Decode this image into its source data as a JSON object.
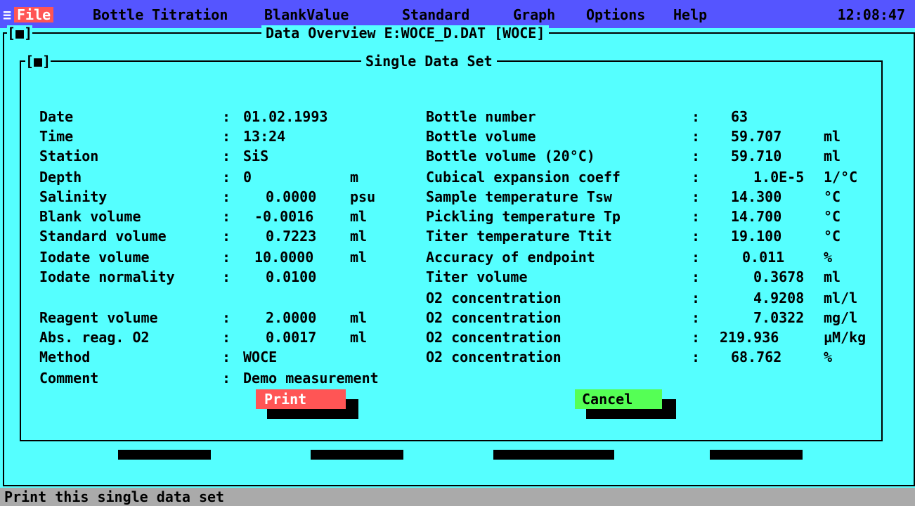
{
  "menu": {
    "sys_icon": "≡",
    "items": [
      "File",
      "Bottle",
      "Titration",
      "BlankValue",
      "Standard",
      "Graph",
      "Options",
      "Help"
    ],
    "clock": "12:08:47"
  },
  "window": {
    "title": "Data Overview E:WOCE_D.DAT [WOCE]",
    "close": "[■]"
  },
  "dialog": {
    "title": "Single Data Set",
    "close": "[■]"
  },
  "left": [
    {
      "label": "Date",
      "sep": ":",
      "value": "01.02.1993",
      "unit": ""
    },
    {
      "label": "Time",
      "sep": ":",
      "value": "13:24",
      "unit": ""
    },
    {
      "label": "Station",
      "sep": ":",
      "value": "SiS",
      "unit": ""
    },
    {
      "label": "Depth",
      "sep": ":",
      "value": "0",
      "unit": "m"
    },
    {
      "label": "Salinity",
      "sep": ":",
      "value": "0.0000",
      "unit": "psu"
    },
    {
      "label": "Blank volume",
      "sep": ":",
      "value": "-0.0016",
      "unit": "ml"
    },
    {
      "label": "Standard volume",
      "sep": ":",
      "value": "0.7223",
      "unit": "ml"
    },
    {
      "label": "Iodate volume",
      "sep": ":",
      "value": "10.0000",
      "unit": "ml"
    },
    {
      "label": "Iodate normality",
      "sep": ":",
      "value": "0.0100",
      "unit": ""
    },
    {
      "label": "Reagent volume",
      "sep": ":",
      "value": "2.0000",
      "unit": "ml"
    },
    {
      "label": "Abs. reag. O2",
      "sep": ":",
      "value": "0.0017",
      "unit": "ml"
    },
    {
      "label": "Method",
      "sep": ":",
      "value": "WOCE",
      "unit": ""
    },
    {
      "label": "Comment",
      "sep": ":",
      "value": "Demo measurement",
      "unit": ""
    }
  ],
  "right": [
    {
      "label": "Bottle number",
      "sep": ":",
      "value": "63",
      "unit": ""
    },
    {
      "label": "Bottle volume",
      "sep": ":",
      "value": "59.707",
      "unit": "ml"
    },
    {
      "label": "Bottle volume (20°C)",
      "sep": ":",
      "value": "59.710",
      "unit": "ml"
    },
    {
      "label": "Cubical expansion coeff",
      "sep": ":",
      "value": "1.0E-5",
      "unit": "1/°C"
    },
    {
      "label": "Sample temperature Tsw",
      "sep": ":",
      "value": "14.300",
      "unit": "°C"
    },
    {
      "label": "Pickling temperature Tp",
      "sep": ":",
      "value": "14.700",
      "unit": "°C"
    },
    {
      "label": "Titer temperature Ttit",
      "sep": ":",
      "value": "19.100",
      "unit": "°C"
    },
    {
      "label": "Accuracy of endpoint",
      "sep": ":",
      "value": "0.011",
      "unit": "%"
    },
    {
      "label": "Titer volume",
      "sep": ":",
      "value": "0.3678",
      "unit": "ml"
    },
    {
      "label": "O2 concentration",
      "sep": ":",
      "value": "4.9208",
      "unit": "ml/l"
    },
    {
      "label": "O2 concentration",
      "sep": ":",
      "value": "7.0322",
      "unit": "mg/l"
    },
    {
      "label": "O2 concentration",
      "sep": ":",
      "value": "219.936",
      "unit": "µM/kg"
    },
    {
      "label": "O2 concentration",
      "sep": ":",
      "value": "68.762",
      "unit": "%"
    }
  ],
  "buttons": {
    "print": "Print",
    "cancel": "Cancel"
  },
  "status": "Print this single data set",
  "colors": {
    "background": "#55ffff",
    "menubar": "#5555ff",
    "print_button": "#ff5555",
    "cancel_button": "#55ff55",
    "status_bar": "#aaaaaa"
  }
}
